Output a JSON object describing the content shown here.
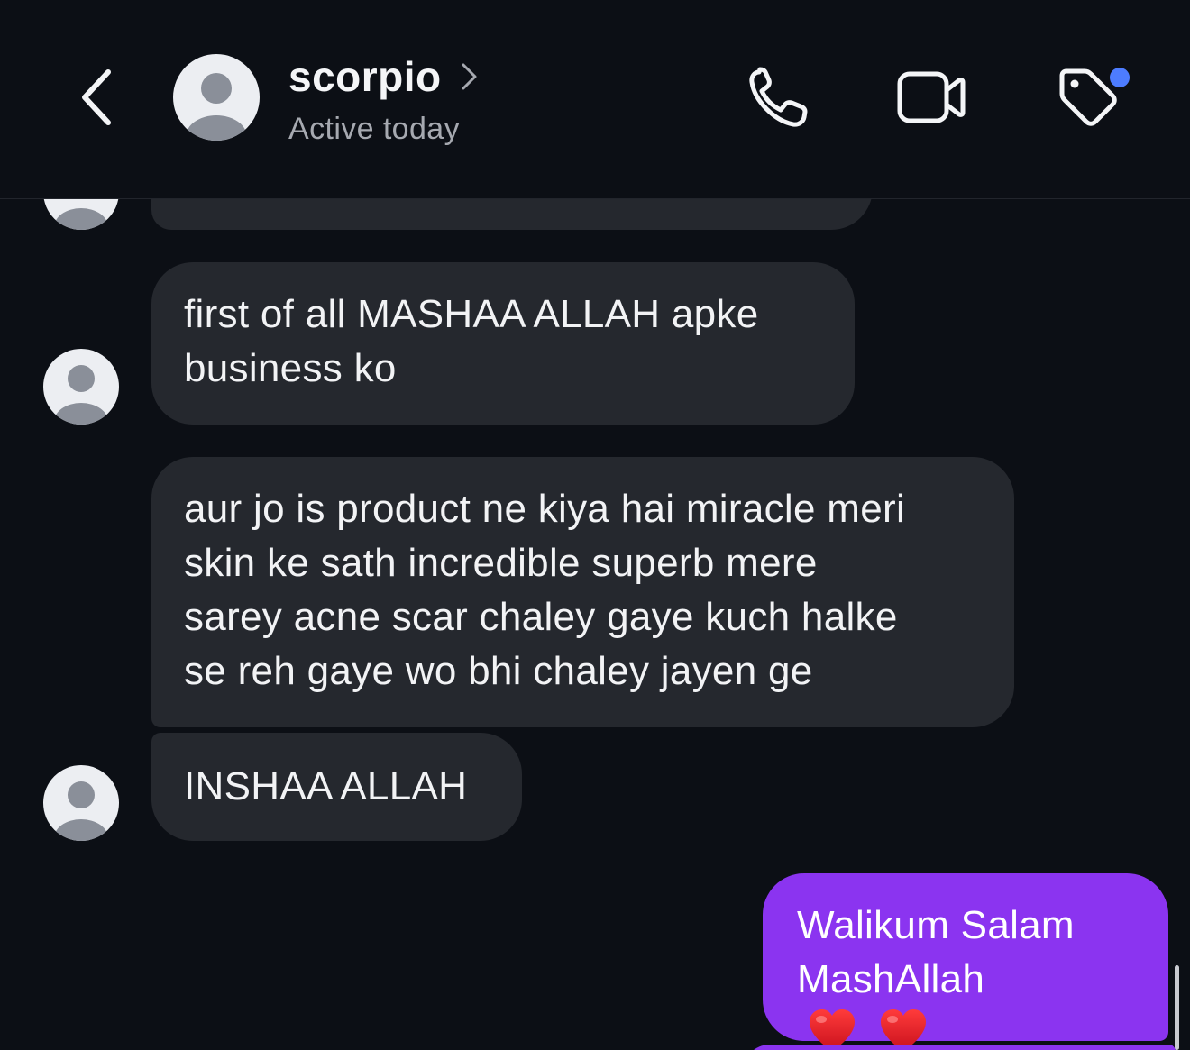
{
  "header": {
    "contact_name": "scorpio",
    "status": "Active today",
    "icons": {
      "back": "chevron-left-icon",
      "name_chevron": "chevron-right-icon",
      "call": "phone-icon",
      "video": "video-camera-icon",
      "tag": "tag-icon"
    },
    "tag_badge_color": "#4d7cff"
  },
  "conversation": {
    "incoming": [
      {
        "text": "first of all MASHAA ALLAH apke business ko",
        "lines": [
          "first of all MASHAA ALLAH apke",
          "business ko"
        ]
      },
      {
        "text": "aur jo is product ne kiya hai miracle meri skin ke sath incredible superb mere sarey acne scar chaley gaye kuch halke se reh gaye wo bhi chaley jayen ge",
        "lines": [
          "aur jo is product ne kiya hai miracle meri",
          "skin ke sath incredible superb mere",
          "sarey acne scar chaley gaye kuch halke",
          "se reh gaye wo bhi chaley jayen ge"
        ]
      },
      {
        "text": "INSHAA ALLAH",
        "lines": [
          "INSHAA ALLAH"
        ]
      }
    ],
    "outgoing": [
      {
        "line1": "Walikum Salam",
        "line2": "MashAllah",
        "emoji": "❤️ ❤️"
      }
    ]
  },
  "colors": {
    "background": "#0c0f15",
    "incoming_bubble": "#25282e",
    "outgoing_bubble": "#8b34f0",
    "secondary_text": "#a6a9b0"
  }
}
